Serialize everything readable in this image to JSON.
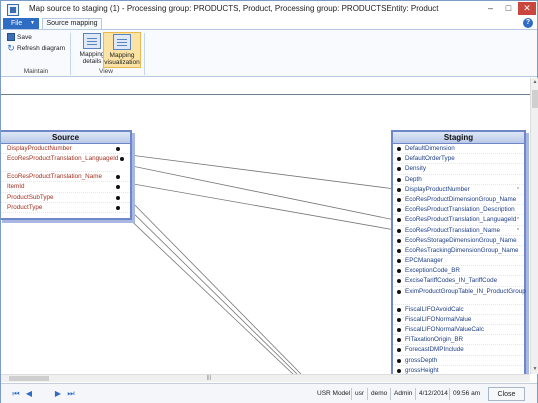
{
  "window": {
    "title": "Map source to staging (1) - Processing group: PRODUCTS, Product, Processing group: PRODUCTSEntity: Product",
    "controls": {
      "minimize": "–",
      "maximize": "□",
      "close": "✕"
    }
  },
  "ribbon": {
    "file_tab": "File",
    "active_tab": "Source mapping",
    "help": "?",
    "maintain": {
      "save": "Save",
      "refresh": "Refresh diagram",
      "group_label": "Maintain"
    },
    "view": {
      "mapping_details": "Mapping details",
      "mapping_visualization": "Mapping visualization",
      "group_label": "View"
    }
  },
  "source": {
    "title": "Source",
    "fields": [
      "DisplayProductNumber",
      "EcoResProductTranslation_LanguageId",
      "EcoResProductTranslation_Name",
      "ItemId",
      "ProductSubType",
      "ProductType"
    ]
  },
  "staging": {
    "title": "Staging",
    "fields": [
      "DefaultDimension",
      "DefaultOrderType",
      "Density",
      "Depth",
      "DisplayProductNumber",
      "EcoResProductDimensionGroup_Name",
      "EcoResProductTranslation_Description",
      "EcoResProductTranslation_LanguageId",
      "EcoResProductTranslation_Name",
      "EcoResStorageDimensionGroup_Name",
      "EcoResTrackingDimensionGroup_Name",
      "EPCManager",
      "ExceptionCode_BR",
      "ExciseTariffCodes_IN_TariffCode",
      "EximProductGroupTable_IN_ProductGroup",
      "FiscalLIFOAvoidCalc",
      "FiscalLIFONormalValue",
      "FiscalLIFONormalValueCalc",
      "FITaxationOrigin_BR",
      "ForecastDMPInclude",
      "grossDepth",
      "grossHeight"
    ]
  },
  "status": {
    "nav": [
      "⏮",
      "◀",
      "▶",
      "⏭"
    ],
    "model": "USR Model",
    "user": "usr",
    "company": "demo",
    "role": "Admin",
    "date": "4/12/2014",
    "time": "09:56 am",
    "close": "Close"
  }
}
